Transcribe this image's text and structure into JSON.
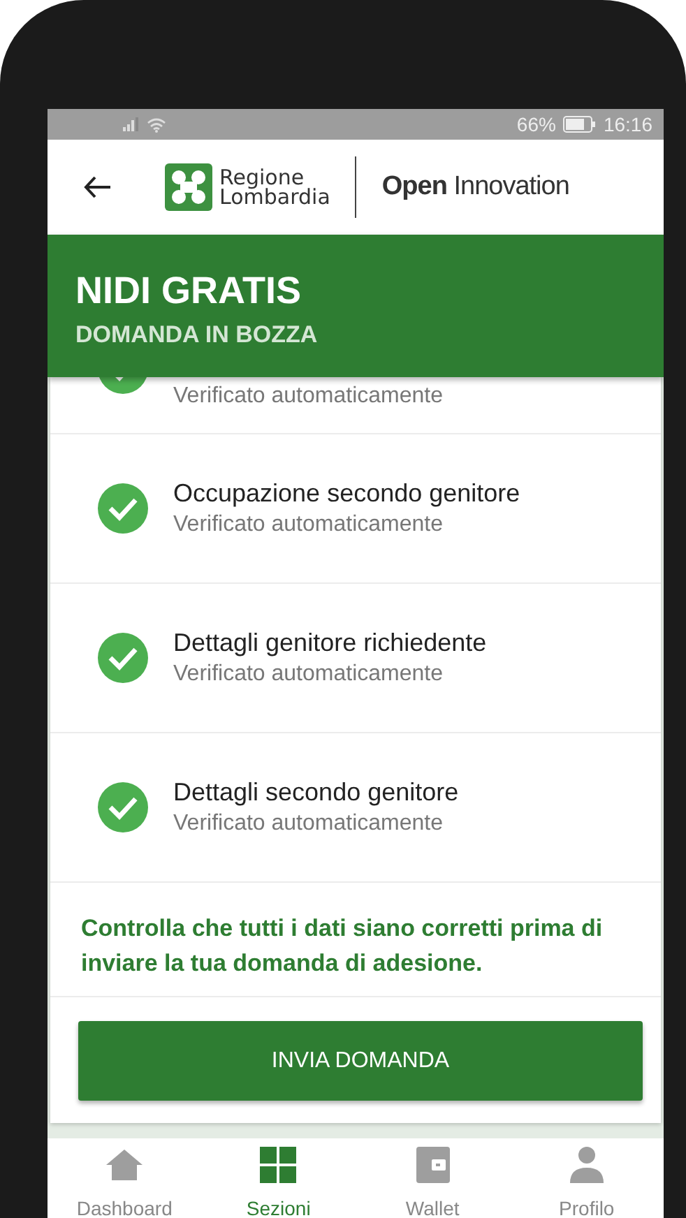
{
  "status_bar": {
    "battery": "66%",
    "time": "16:16"
  },
  "header": {
    "logo_line_1": "Regione",
    "logo_line_2": "Lombardia",
    "brand_bold": "Open",
    "brand_rest": "Innovation"
  },
  "banner": {
    "title": "NIDI GRATIS",
    "subtitle": "DOMANDA IN BOZZA"
  },
  "checks": [
    {
      "kind": "partial",
      "subtitle": "Verificato automaticamente",
      "checked": true
    },
    {
      "kind": "full",
      "title": "Occupazione secondo genitore",
      "subtitle": "Verificato automaticamente",
      "checked": true
    },
    {
      "kind": "full",
      "title": "Dettagli genitore richiedente",
      "subtitle": "Verificato automaticamente",
      "checked": true
    },
    {
      "kind": "full",
      "title": "Dettagli secondo genitore",
      "subtitle": "Verificato automaticamente",
      "checked": true
    }
  ],
  "note": "Controlla che tutti i dati siano corretti prima di inviare la tua domanda di adesione.",
  "submit_button": "INVIA DOMANDA",
  "nav": [
    {
      "kind": "home",
      "label": "Dashboard",
      "selected": false
    },
    {
      "kind": "grid",
      "label": "Sezioni",
      "selected": true
    },
    {
      "kind": "wallet",
      "label": "Wallet",
      "selected": false
    },
    {
      "kind": "person",
      "label": "Profilo",
      "selected": false
    }
  ]
}
